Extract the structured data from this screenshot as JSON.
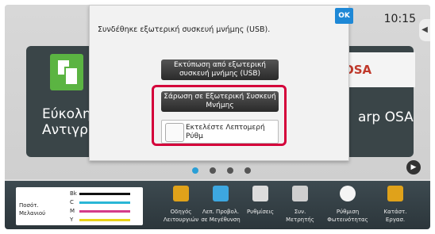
{
  "status": {
    "time": "10:15"
  },
  "tiles": {
    "left_label": "Εύκολη\nΑντιγραφ",
    "right_label": "arp OSA",
    "right_logo_text": "OSA"
  },
  "pager": {
    "count": 4,
    "active_index": 0
  },
  "bottom": {
    "toner_label": "Ποσότ. Μελανιού",
    "toner_rows": [
      {
        "code": "Bk",
        "color": "#111111"
      },
      {
        "code": "C",
        "color": "#2ab6d6"
      },
      {
        "code": "M",
        "color": "#d43c8a"
      },
      {
        "code": "Y",
        "color": "#e8d21b"
      }
    ],
    "items": [
      {
        "label": "Οδηγός Λειτουργιών",
        "icon": "guide-icon",
        "color": "#e0a21a"
      },
      {
        "label": "Λεπ. Προβολ. σε Μεγέθυνση",
        "icon": "magnify-text-icon",
        "color": "#3da7e0"
      },
      {
        "label": "Ρυθμίσεις",
        "icon": "tools-icon",
        "color": "#dcdcdc"
      },
      {
        "label": "Συν. Μετρητής",
        "icon": "counter-icon",
        "color": "#cfcfcf"
      },
      {
        "label": "Ρύθμιση Φωτεινότητας",
        "icon": "brightness-icon",
        "color": "#f4f4f4"
      },
      {
        "label": "Κατάστ. Εργασ.",
        "icon": "job-status-icon",
        "color": "#e0a21a"
      }
    ]
  },
  "dialog": {
    "message": "Συνδέθηκε εξωτερική συσκευή μνήμης (USB).",
    "ok_label": "OK",
    "print_usb_label": "Εκτύπωση από εξωτερική συσκευή μνήμης (USB)",
    "scan_label": "Σάρωση σε Εξωτερική Συσκευή Μνήμης",
    "detail_label": "Εκτελέστε Λεπτομερή Ρύθμ",
    "detail_checked": false
  }
}
